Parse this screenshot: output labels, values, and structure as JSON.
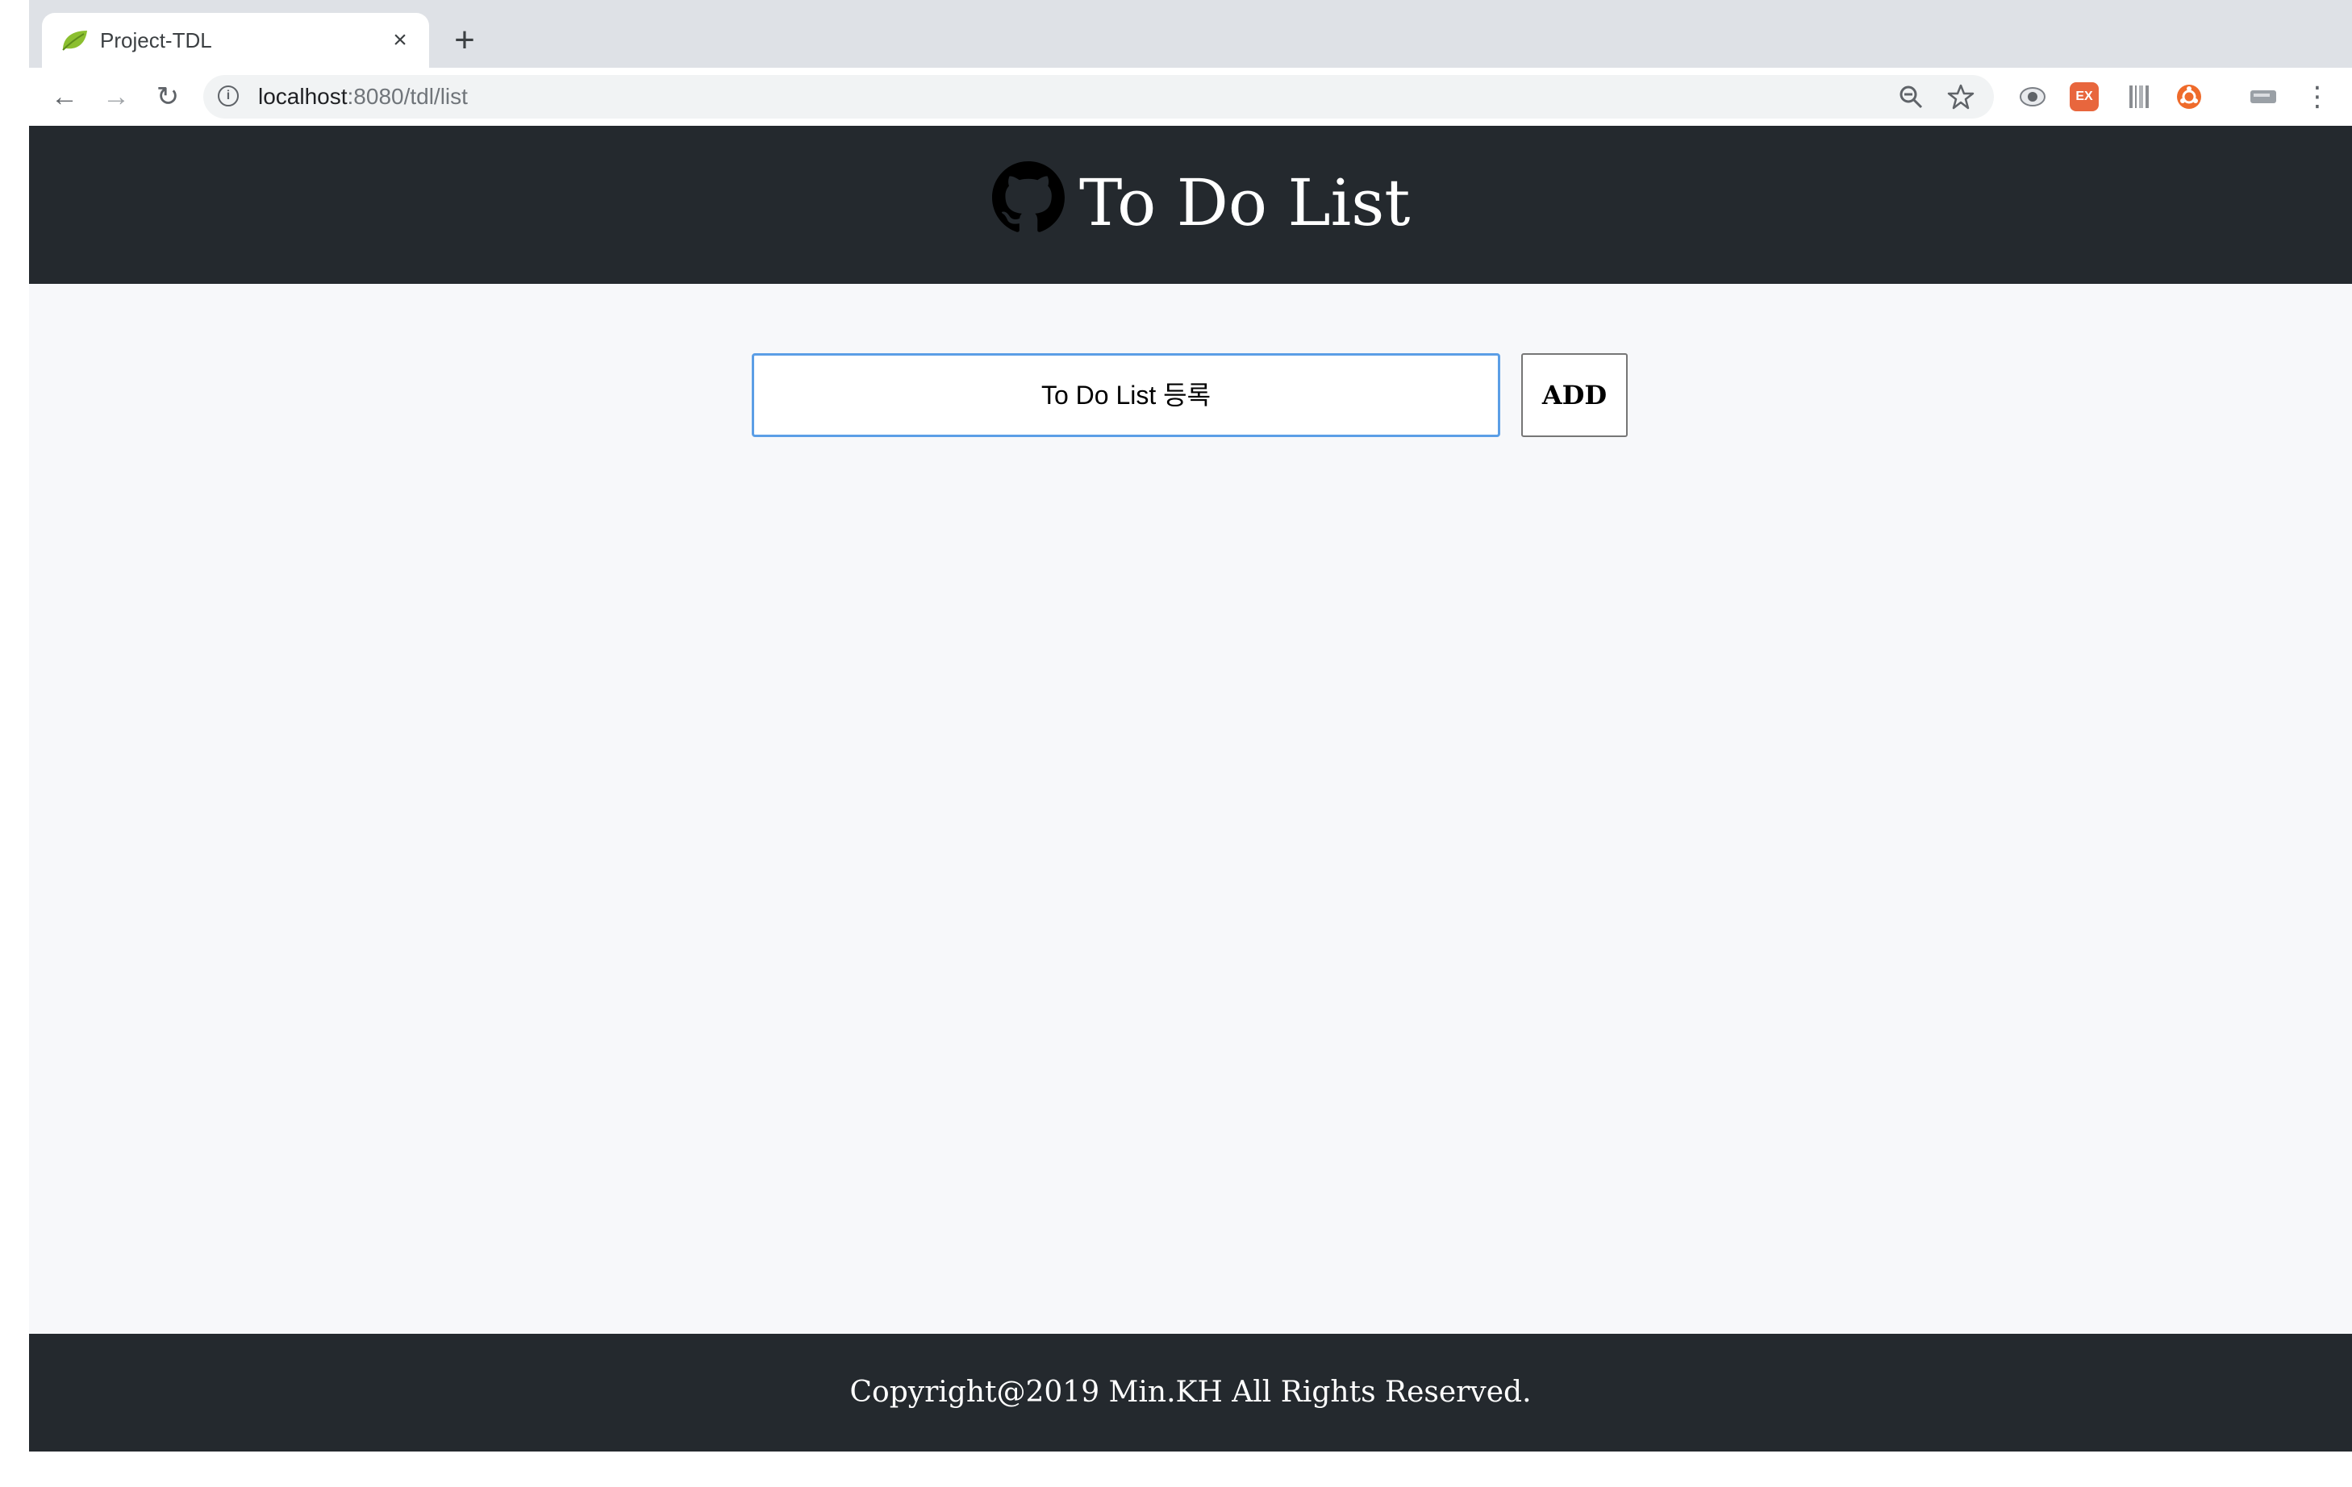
{
  "browser": {
    "tab": {
      "title": "Project-TDL",
      "close": "×"
    },
    "new_tab": "+",
    "nav": {
      "back": "←",
      "forward": "→",
      "reload": "↻"
    },
    "address": {
      "host": "localhost",
      "path": ":8080/tdl/list"
    },
    "icons": {
      "favicon": "spring-leaf-icon",
      "info": "info-icon",
      "zoom": "zoom-out-icon",
      "bookmark": "star-icon",
      "menu": "kebab-menu-icon"
    },
    "extensions": [
      {
        "name": "eye-extension-icon",
        "color": "#7b7f85"
      },
      {
        "name": "ex-extension-icon",
        "label": "EX",
        "color": "#e8663d"
      },
      {
        "name": "barcode-extension-icon",
        "color": "#8a8d91"
      },
      {
        "name": "ubuntu-extension-icon",
        "color": "#ef6b2b"
      },
      {
        "name": "ticket-extension-icon",
        "color": "#9aa0a6"
      }
    ]
  },
  "header": {
    "title": "To Do List",
    "logo": "github-icon"
  },
  "form": {
    "input_placeholder": "To Do List 등록",
    "add_label": "ADD"
  },
  "footer": {
    "text": "Copyright@2019 Min.KH All Rights Reserved."
  },
  "colors": {
    "dark": "#24292e",
    "background": "#f7f8fa",
    "input_focus": "#5b9ee6"
  }
}
